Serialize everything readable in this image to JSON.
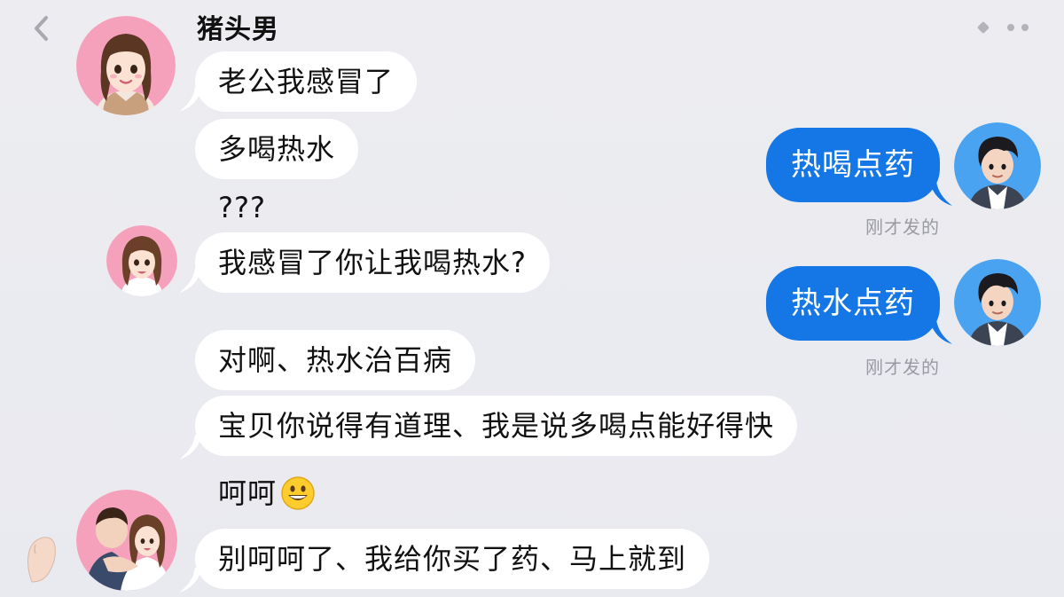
{
  "header": {
    "back_icon": "chevron-left-icon",
    "more_icon": "more-dots-icon",
    "contact_name": "猪头男"
  },
  "incoming": [
    {
      "text": "老公我感冒了"
    },
    {
      "text": "多喝热水"
    },
    {
      "text": "???"
    },
    {
      "text": "我感冒了你让我喝热水?"
    },
    {
      "text": "对啊、热水治百病"
    },
    {
      "text": "宝贝你说得有道理、我是说多喝点能好得快"
    },
    {
      "text": "呵呵",
      "emoji": "grinning-face"
    },
    {
      "text": "别呵呵了、我给你买了药、马上就到"
    }
  ],
  "outgoing": [
    {
      "text": "热喝点药",
      "timestamp": "刚才发的"
    },
    {
      "text": "热水点药",
      "timestamp": "刚才发的"
    }
  ],
  "colors": {
    "background": "#ebebf0",
    "bubble_incoming": "#ffffff",
    "bubble_outgoing": "#1577e5",
    "avatar_female_bg": "#f5a1bb",
    "avatar_male_bg": "#4aa3f0"
  }
}
